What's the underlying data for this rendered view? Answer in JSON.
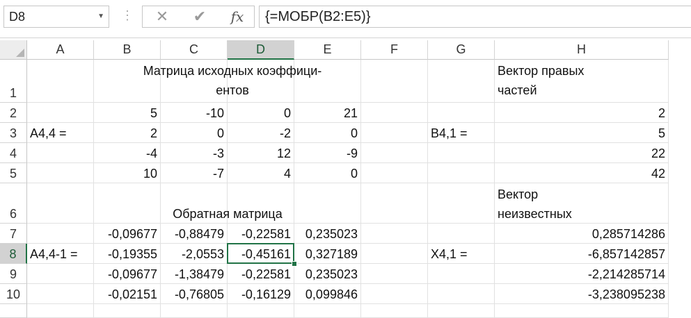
{
  "formula_bar": {
    "name_box": "D8",
    "cancel_icon": "✕",
    "enter_icon": "✔",
    "fx_label": "fx",
    "formula": "{=МОБР(B2:E5)}"
  },
  "columns": [
    "A",
    "B",
    "C",
    "D",
    "E",
    "F",
    "G",
    "H"
  ],
  "selected_column": "D",
  "rows": [
    "1",
    "2",
    "3",
    "4",
    "5",
    "6",
    "7",
    "8",
    "9",
    "10"
  ],
  "selected_row": "8",
  "cells": {
    "B1": "Матрица исходных коэффици-ентов",
    "H1": "Вектор правых частей",
    "B2": "5",
    "C2": "-10",
    "D2": "0",
    "E2": "21",
    "H2": "2",
    "A3": "A4,4 =",
    "B3": "2",
    "C3": "0",
    "D3": "-2",
    "E3": "0",
    "G3": "B4,1 =",
    "H3": "5",
    "B4": "-4",
    "C4": "-3",
    "D4": "12",
    "E4": "-9",
    "H4": "22",
    "B5": "10",
    "C5": "-7",
    "D5": "4",
    "E5": "0",
    "H5": "42",
    "B6": "Обратная матрица",
    "H6": "Вектор неизвестных",
    "B7": "-0,09677",
    "C7": "-0,88479",
    "D7": "-0,22581",
    "E7": "0,235023",
    "H7": "0,285714286",
    "A8": "A4,4-1 =",
    "B8": "-0,19355",
    "C8": "-2,0553",
    "D8": "-0,45161",
    "E8": "0,327189",
    "G8": "X4,1 =",
    "H8": "-6,857142857",
    "B9": "-0,09677",
    "C9": "-1,38479",
    "D9": "-0,22581",
    "E9": "0,235023",
    "H9": "-2,214285714",
    "B10": "-0,02151",
    "C10": "-0,76805",
    "D10": "-0,16129",
    "E10": "0,099846",
    "H10": "-3,238095238"
  }
}
